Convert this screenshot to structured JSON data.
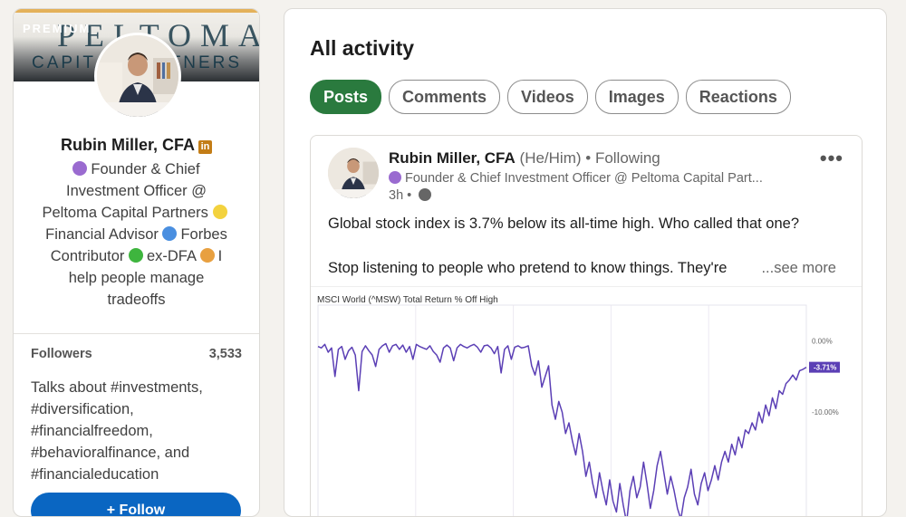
{
  "sidebar": {
    "premium_label": "PREMIUM",
    "banner_logo": "PELTOMA",
    "banner_sub": "CAPITAL PARTNERS",
    "name": "Rubin Miller, CFA",
    "linkedin_badge": "in",
    "headline_parts": [
      "Founder & Chief Investment Officer @ Peltoma Capital Partners ",
      "Financial Advisor ",
      "Forbes Contributor ",
      "ex-DFA ",
      "I help people manage tradeoffs"
    ],
    "followers_label": "Followers",
    "followers_value": "3,533",
    "talks_about": "Talks about #investments, #diversification, #financialfreedom, #behavioralfinance, and #financialeducation",
    "button_label": "+ Follow",
    "colors": {
      "purple": "#9a6bd0",
      "yellow": "#f3d23e",
      "blue": "#4a8fe0",
      "green": "#3eb53e",
      "orange": "#e8a040"
    }
  },
  "main": {
    "title": "All activity",
    "tabs": [
      {
        "label": "Posts",
        "active": true
      },
      {
        "label": "Comments",
        "active": false
      },
      {
        "label": "Videos",
        "active": false
      },
      {
        "label": "Images",
        "active": false
      },
      {
        "label": "Reactions",
        "active": false
      }
    ],
    "post": {
      "author": "Rubin Miller, CFA",
      "pronoun": "(He/Him)",
      "follow_status": "• Following",
      "headline": "Founder & Chief Investment Officer @ Peltoma Capital Part...",
      "time": "3h •",
      "more_icon": "•••",
      "text_line1": "Global stock index is 3.7% below its all-time high. Who called that one?",
      "text_line2": "Stop listening to people who pretend to know things. They're",
      "see_more": "...see more"
    }
  },
  "chart_data": {
    "type": "line",
    "title": "MSCI World (^MSW) Total Return % Off High",
    "ytick_labels": [
      "0.00%",
      "-10.00%"
    ],
    "last_value_label": "-3.71%",
    "series": [
      {
        "color": "#5b3fb5",
        "values": [
          -0.8,
          -1.0,
          -0.5,
          -1.6,
          -1.0,
          -5.0,
          -1.2,
          -0.8,
          -2.6,
          -1.4,
          -0.9,
          -2.0,
          -7.0,
          -1.5,
          -0.7,
          -1.4,
          -2.0,
          -3.6,
          -1.2,
          -0.7,
          -0.4,
          -1.6,
          -0.7,
          -0.5,
          -1.2,
          -0.6,
          -1.6,
          -0.8,
          -2.6,
          -0.5,
          -0.8,
          -1.0,
          -1.2,
          -0.7,
          -1.5,
          -2.0,
          -3.0,
          -1.0,
          -0.6,
          -1.0,
          -2.8,
          -1.0,
          -0.5,
          -0.8,
          -1.0,
          -0.7,
          -0.5,
          -0.9,
          -1.6,
          -0.7,
          -0.6,
          -1.0,
          -1.8,
          -0.8,
          -4.5,
          -1.2,
          -0.7,
          -2.6,
          -0.9,
          -0.7,
          -1.0,
          -0.9,
          -0.7,
          -3.5,
          -4.8,
          -2.8,
          -6.5,
          -5.0,
          -3.5,
          -9.0,
          -11.0,
          -8.5,
          -10.0,
          -13.0,
          -11.5,
          -14.0,
          -16.0,
          -13.0,
          -15.5,
          -19.0,
          -17.0,
          -20.0,
          -22.0,
          -18.5,
          -21.0,
          -23.0,
          -19.5,
          -22.5,
          -24.0,
          -20.0,
          -23.0,
          -25.5,
          -21.0,
          -19.0,
          -22.0,
          -20.5,
          -17.0,
          -20.0,
          -23.5,
          -21.0,
          -17.5,
          -15.5,
          -18.5,
          -21.5,
          -19.0,
          -21.0,
          -23.5,
          -25.0,
          -22.0,
          -20.5,
          -18.0,
          -21.5,
          -23.0,
          -20.0,
          -18.5,
          -21.0,
          -19.5,
          -17.5,
          -19.5,
          -17.0,
          -15.5,
          -17.0,
          -14.5,
          -16.0,
          -13.5,
          -15.0,
          -12.5,
          -13.0,
          -11.5,
          -12.5,
          -10.0,
          -11.5,
          -9.0,
          -10.5,
          -8.0,
          -9.5,
          -7.0,
          -7.5,
          -6.0,
          -5.5,
          -4.8,
          -5.5,
          -4.2,
          -4.0,
          -3.71
        ]
      }
    ],
    "ylim": [
      -28,
      5
    ]
  }
}
